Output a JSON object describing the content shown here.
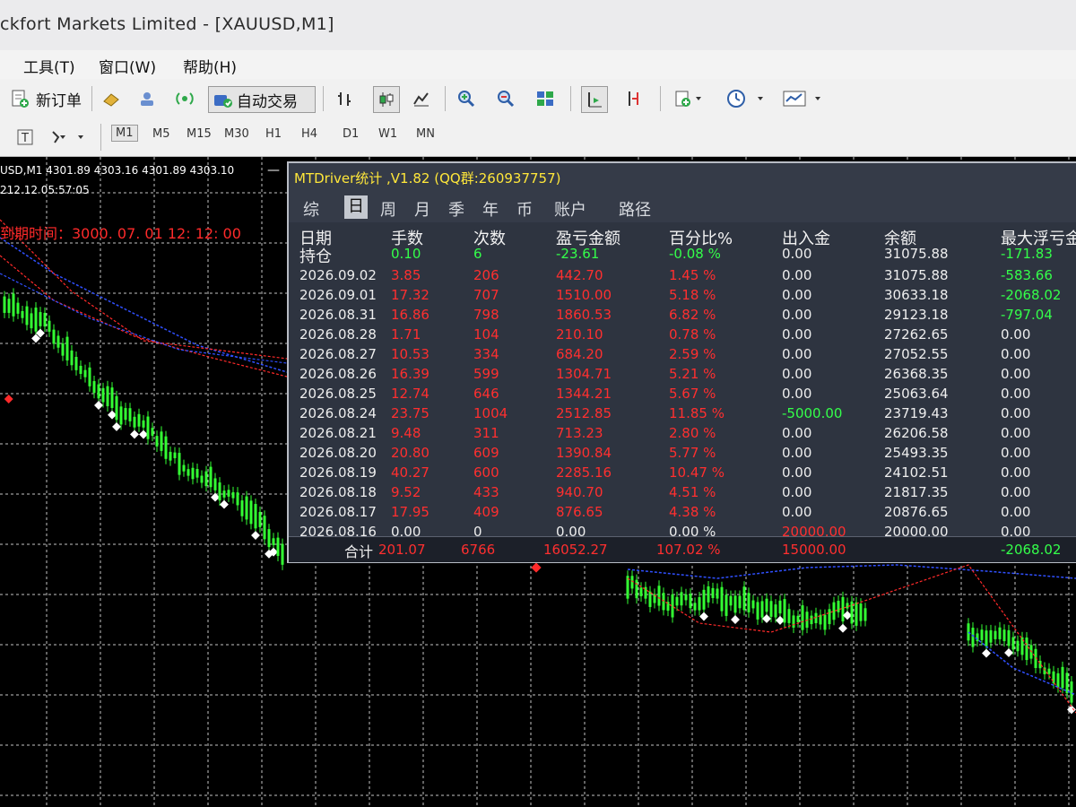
{
  "window": {
    "title": "ckfort Markets Limited - [XAUUSD,M1]"
  },
  "menu": [
    {
      "label": "工具(T)"
    },
    {
      "label": "窗口(W)"
    },
    {
      "label": "帮助(H)"
    }
  ],
  "toolbar": {
    "new_order": "新订单",
    "auto_trading": "自动交易",
    "icons": [
      "new-order-icon",
      "navigator-icon",
      "market-watch-icon",
      "signals-icon",
      "autotrading-icon",
      "bar-chart-icon",
      "candlestick-icon",
      "line-chart-icon",
      "zoom-in-icon",
      "zoom-out-icon",
      "tile-windows-icon",
      "chart-shift-icon",
      "autoscroll-icon",
      "indicators-icon",
      "periods-icon",
      "templates-icon"
    ]
  },
  "timeframes": [
    "M1",
    "M5",
    "M15",
    "M30",
    "H1",
    "H4",
    "D1",
    "W1",
    "MN"
  ],
  "active_timeframe": "M1",
  "chart": {
    "quote": "USD,M1  4301.89 4303.16 4301.89 4303.10",
    "time": "212.12    05:57:05",
    "expiry": "到期时间：3000. 07. 01  12: 12: 00",
    "colors": {
      "background": "#000000",
      "grid": "#e8e8e8",
      "bull": "#33ff33",
      "bear": "#ffffff",
      "ma_red": "#ff2a2a",
      "ma_blue": "#3050ff"
    }
  },
  "panel": {
    "title": "MTDriver统计 ,V1.82 (QQ群:260937757)",
    "tabs": [
      "综",
      "日",
      "周",
      "月",
      "季",
      "年",
      "币",
      "账户",
      "路径"
    ],
    "active_tab": "日",
    "headers": [
      "日期",
      "手数",
      "次数",
      "盈亏金额",
      "百分比%",
      "出入金",
      "余额",
      "最大浮亏金"
    ],
    "position_row": {
      "label": "持仓",
      "cells": [
        "0.10",
        "6",
        "-23.61",
        "-0.08 %",
        "0.00",
        "31075.88",
        "-171.83"
      ]
    },
    "rows": [
      {
        "date": "2026.09.02",
        "cells": [
          "3.85",
          "206",
          "442.70",
          "1.45 %",
          "0.00",
          "31075.88",
          "-583.66"
        ]
      },
      {
        "date": "2026.09.01",
        "cells": [
          "17.32",
          "707",
          "1510.00",
          "5.18 %",
          "0.00",
          "30633.18",
          "-2068.02"
        ]
      },
      {
        "date": "2026.08.31",
        "cells": [
          "16.86",
          "798",
          "1860.53",
          "6.82 %",
          "0.00",
          "29123.18",
          "-797.04"
        ]
      },
      {
        "date": "2026.08.28",
        "cells": [
          "1.71",
          "104",
          "210.10",
          "0.78 %",
          "0.00",
          "27262.65",
          "0.00"
        ]
      },
      {
        "date": "2026.08.27",
        "cells": [
          "10.53",
          "334",
          "684.20",
          "2.59 %",
          "0.00",
          "27052.55",
          "0.00"
        ]
      },
      {
        "date": "2026.08.26",
        "cells": [
          "16.39",
          "599",
          "1304.71",
          "5.21 %",
          "0.00",
          "26368.35",
          "0.00"
        ]
      },
      {
        "date": "2026.08.25",
        "cells": [
          "12.74",
          "646",
          "1344.21",
          "5.67 %",
          "0.00",
          "25063.64",
          "0.00"
        ]
      },
      {
        "date": "2026.08.24",
        "cells": [
          "23.75",
          "1004",
          "2512.85",
          "11.85 %",
          "-5000.00",
          "23719.43",
          "0.00"
        ]
      },
      {
        "date": "2026.08.21",
        "cells": [
          "9.48",
          "311",
          "713.23",
          "2.80 %",
          "0.00",
          "26206.58",
          "0.00"
        ]
      },
      {
        "date": "2026.08.20",
        "cells": [
          "20.80",
          "609",
          "1390.84",
          "5.77 %",
          "0.00",
          "25493.35",
          "0.00"
        ]
      },
      {
        "date": "2026.08.19",
        "cells": [
          "40.27",
          "600",
          "2285.16",
          "10.47 %",
          "0.00",
          "24102.51",
          "0.00"
        ]
      },
      {
        "date": "2026.08.18",
        "cells": [
          "9.52",
          "433",
          "940.70",
          "4.51 %",
          "0.00",
          "21817.35",
          "0.00"
        ]
      },
      {
        "date": "2026.08.17",
        "cells": [
          "17.95",
          "409",
          "876.65",
          "4.38 %",
          "0.00",
          "20876.65",
          "0.00"
        ]
      },
      {
        "date": "2026.08.16",
        "cells": [
          "0.00",
          "0",
          "0.00",
          "0.00 %",
          "20000.00",
          "20000.00",
          "0.00"
        ]
      }
    ],
    "totals": {
      "label": "合计",
      "cells": [
        "201.07",
        "6766",
        "16052.27",
        "107.02 %",
        "15000.00",
        "",
        "-2068.02"
      ]
    },
    "colors": {
      "positive": "#ff2f2f",
      "negative": "#34ff4a",
      "neutral": "#eeeeee",
      "title": "#ffe73a"
    }
  }
}
